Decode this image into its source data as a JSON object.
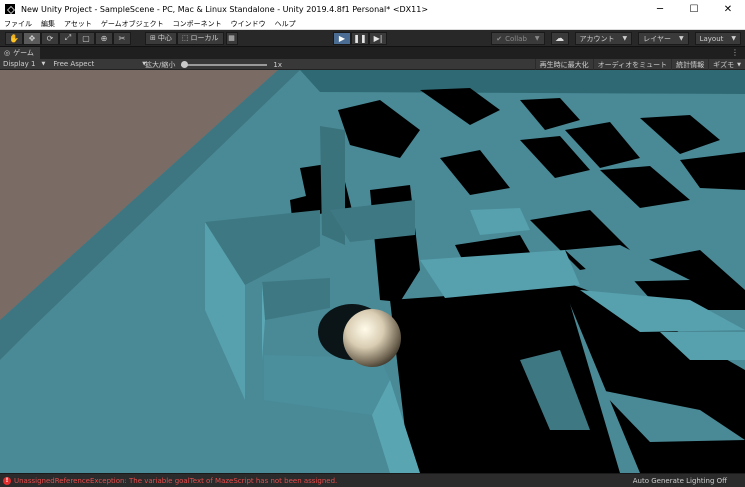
{
  "window": {
    "title": "New Unity Project - SampleScene - PC, Mac & Linux Standalone - Unity 2019.4.8f1 Personal* <DX11>",
    "minimize": "─",
    "maximize": "☐",
    "close": "✕"
  },
  "menu": [
    "ファイル",
    "編集",
    "アセット",
    "ゲームオブジェクト",
    "コンポーネント",
    "ウインドウ",
    "ヘルプ"
  ],
  "toolbar": {
    "tools": [
      {
        "name": "hand-tool",
        "glyph": "✋"
      },
      {
        "name": "move-tool",
        "glyph": "✥"
      },
      {
        "name": "rotate-tool",
        "glyph": "⟳"
      },
      {
        "name": "scale-tool",
        "glyph": "⤢"
      },
      {
        "name": "rect-tool",
        "glyph": "▢"
      },
      {
        "name": "transform-tool",
        "glyph": "⊕"
      },
      {
        "name": "custom-tool",
        "glyph": "✂"
      }
    ],
    "pivot_label": "中心",
    "space_label": "ローカル",
    "play": "▶",
    "pause": "❚❚",
    "step": "▶|",
    "collab_label": "Collab",
    "account_label": "アカウント",
    "layers_label": "レイヤー",
    "layout_label": "Layout"
  },
  "tab": {
    "label": "ゲーム"
  },
  "game_toolbar": {
    "display": "Display 1",
    "aspect": "Free Aspect",
    "scale_label": "拡大/縮小",
    "scale_value": "1x",
    "toggles": [
      "再生時に最大化",
      "オーディオをミュート",
      "統計情報",
      "ギズモ"
    ]
  },
  "status": {
    "error_text": "UnassignedReferenceException: The variable goalText of MazeScript has not been assigned.",
    "lighting_text": "Auto Generate Lighting Off"
  },
  "colors": {
    "play_active": "#4b6d94",
    "wall": "#4a8a97",
    "error": "#e84a4a"
  }
}
